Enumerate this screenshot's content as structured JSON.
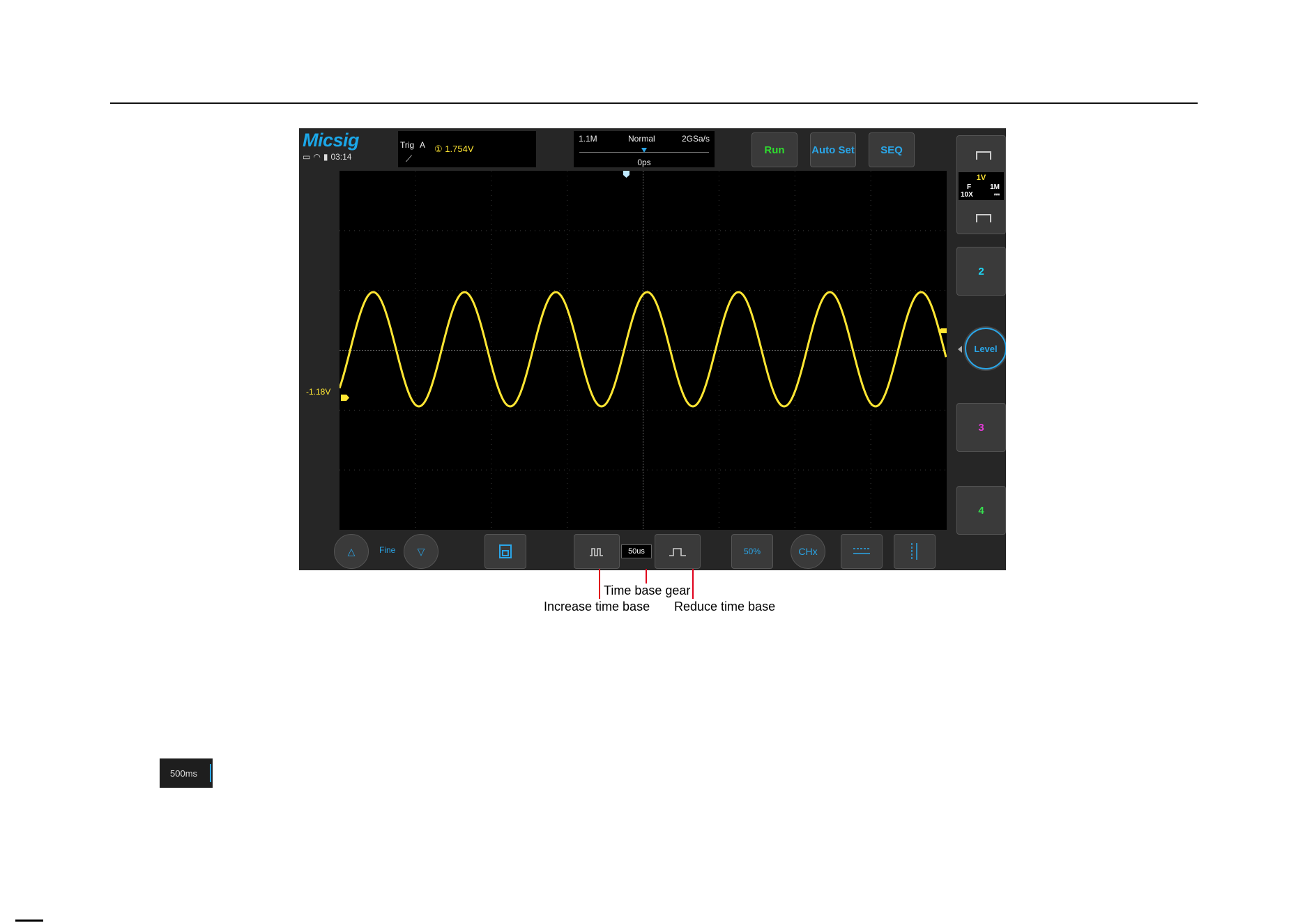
{
  "brand": {
    "logo": "Micsig",
    "time": "03:14"
  },
  "trigger": {
    "label": "Trig",
    "source": "A",
    "channel_marker": "①",
    "level": "1.754V"
  },
  "timebar": {
    "memory": "1.1M",
    "mode": "Normal",
    "sample_rate": "2GSa/s",
    "position": "0ps"
  },
  "top_buttons": {
    "run": "Run",
    "auto": "Auto Set",
    "seq": "SEQ"
  },
  "channel1": {
    "volts": "1V",
    "coupling": "F",
    "impedance": "1M",
    "probe": "10X",
    "dc": "⎓"
  },
  "channels": {
    "ch2": "2",
    "ch3": "3",
    "ch4": "4"
  },
  "level_button": "Level",
  "offset_label": "-1.18V",
  "bottom": {
    "fine": "Fine",
    "gear": "50us",
    "fifty": "50%",
    "chx": "CHx"
  },
  "callouts": {
    "gear": "Time base gear",
    "increase": "Increase time base",
    "reduce": "Reduce time base"
  },
  "gear_sample": "500ms",
  "colors": {
    "trace": "#ffe633",
    "accent": "#2aa6e8",
    "run": "#2edc2e",
    "ch2": "#1fd6f5",
    "ch3": "#e43bd7",
    "ch4": "#36e04f",
    "callout": "#e0001c"
  }
}
